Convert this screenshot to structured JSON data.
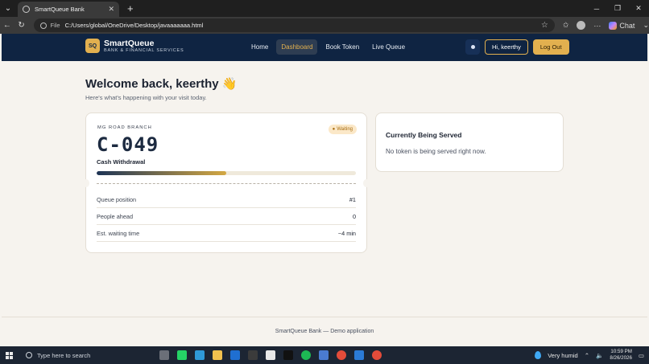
{
  "browser": {
    "tab_title": "SmartQueue Bank",
    "url_scheme_label": "File",
    "url": "C:/Users/global/OneDrive/Desktop/javaaaaaaa.html",
    "copilot_label": "Chat"
  },
  "header": {
    "logo_badge": "SQ",
    "brand_name": "SmartQueue",
    "brand_sub": "BANK & FINANCIAL SERVICES",
    "nav": [
      {
        "label": "Home"
      },
      {
        "label": "Dashboard"
      },
      {
        "label": "Book Token"
      },
      {
        "label": "Live Queue"
      }
    ],
    "greeting_button": "Hi, keerthy",
    "logout_button": "Log Out"
  },
  "main": {
    "welcome": "Welcome back, keerthy 👋",
    "subtitle": "Here's what's happening with your visit today.",
    "ticket": {
      "branch": "MG ROAD BRANCH",
      "status": "Waiting",
      "token": "C-049",
      "service": "Cash Withdrawal",
      "progress_percent": 50,
      "rows": [
        {
          "label": "Queue position",
          "value": "#1"
        },
        {
          "label": "People ahead",
          "value": "0"
        },
        {
          "label": "Est. waiting time",
          "value": "~4 min"
        }
      ]
    },
    "served": {
      "title": "Currently Being Served",
      "text": "No token is being served right now."
    }
  },
  "footer": {
    "text": "SmartQueue Bank — Demo application"
  },
  "taskbar": {
    "search_placeholder": "Type here to search",
    "weather": "Very humid",
    "time": "10:59 PM",
    "date": "8/26/2026"
  }
}
